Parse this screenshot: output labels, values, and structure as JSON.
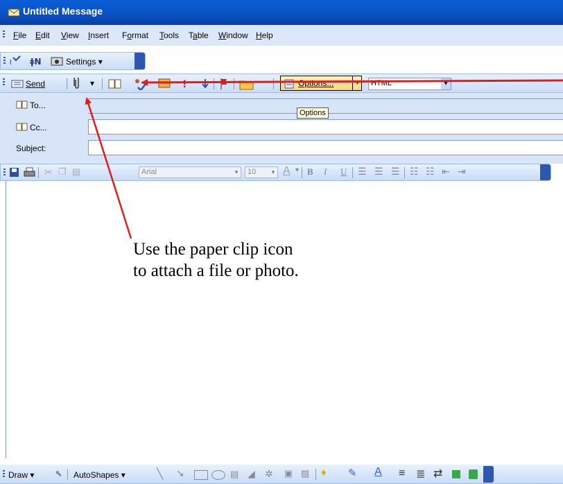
{
  "window": {
    "title": "Untitled Message"
  },
  "menu": [
    "File",
    "Edit",
    "View",
    "Insert",
    "Format",
    "Tools",
    "Table",
    "Window",
    "Help"
  ],
  "toolbar1": {
    "settings_label": "Settings ▾"
  },
  "toolbar2": {
    "send_label": "Send",
    "options_label": "Options...",
    "format_value": "HTML",
    "tooltip": "Options"
  },
  "fields": {
    "to_label": "To...",
    "cc_label": "Cc...",
    "subject_label": "Subject:"
  },
  "formatting": {
    "font_value": "Arial",
    "size_value": "10",
    "bold": "B",
    "italic": "I",
    "underline": "U"
  },
  "annotation": {
    "text": "Use the paper clip icon to attach a file or photo."
  },
  "drawbar": {
    "draw_label": "Draw ▾",
    "autoshapes_label": "AutoShapes ▾"
  },
  "colors": {
    "titlebar": "#0a4fc3",
    "arrow": "#e31b1b",
    "toolbar": "#c9dcf7"
  },
  "icons": [
    "message-icon",
    "paperclip-icon",
    "address-book-icon",
    "check-names-icon",
    "flag-icon",
    "importance-high-icon",
    "importance-low-icon",
    "save-icon",
    "print-icon",
    "cut-icon",
    "copy-icon",
    "paste-icon"
  ]
}
